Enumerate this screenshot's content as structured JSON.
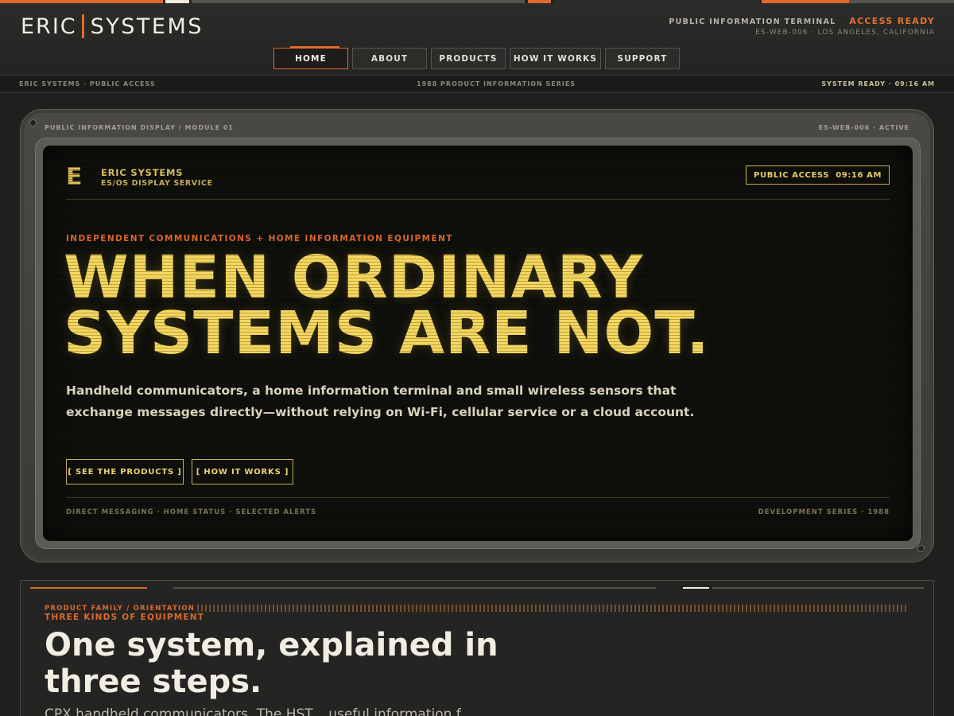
{
  "brand": {
    "name_left": "ERIC",
    "name_right": "SYSTEMS"
  },
  "header": {
    "terminal_label": "PUBLIC INFORMATION TERMINAL",
    "access_status": "ACCESS READY",
    "location": "ES-WEB-006 · LOS ANGELES, CALIFORNIA"
  },
  "nav": {
    "items": [
      {
        "label": "HOME",
        "active": true
      },
      {
        "label": "ABOUT"
      },
      {
        "label": "PRODUCTS"
      },
      {
        "label": "HOW IT WORKS"
      },
      {
        "label": "SUPPORT"
      }
    ]
  },
  "status_bar": {
    "left": "ERIC SYSTEMS · PUBLIC ACCESS",
    "center": "1988 PRODUCT INFORMATION SERIES",
    "right": "SYSTEM READY · 09:16 AM"
  },
  "frame": {
    "label_left": "PUBLIC INFORMATION DISPLAY / MODULE 01",
    "label_right": "ES-WEB-006 · ACTIVE"
  },
  "screen": {
    "logo_letter": "E",
    "brand_title": "ERIC SYSTEMS",
    "brand_subtitle": "ES/OS DISPLAY SERVICE",
    "access_badge": "PUBLIC ACCESS  09:16 AM",
    "kicker": "INDEPENDENT COMMUNICATIONS + HOME INFORMATION EQUIPMENT",
    "headline_line1": "WHEN ORDINARY",
    "headline_line2": "SYSTEMS ARE NOT.",
    "lede": "Handheld communicators, a home information terminal and small wireless sensors that exchange messages directly—without relying on Wi-Fi, cellular service or a cloud account.",
    "cta_products": "[ SEE THE PRODUCTS ]",
    "cta_how": "[ HOW IT WORKS ]",
    "footer_left": "DIRECT MESSAGING · HOME STATUS · SELECTED ALERTS",
    "footer_right": "DEVELOPMENT SERIES · 1988"
  },
  "section": {
    "kicker_line1": "PRODUCT FAMILY / ORIENTATION",
    "kicker_line2": "THREE KINDS OF EQUIPMENT",
    "title": "One system, explained in three steps.",
    "body_partial": "CPX handheld communicators. The HST... useful information f..."
  },
  "colors": {
    "accent": "#e06a2c",
    "crt_amber": "#f0d45e",
    "background": "#1f1f1d"
  }
}
